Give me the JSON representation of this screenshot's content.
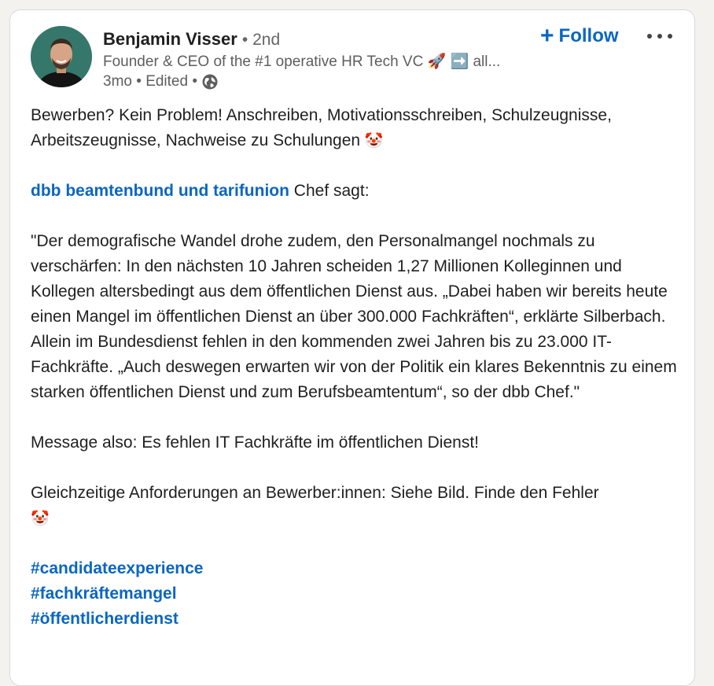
{
  "post": {
    "author": {
      "name": "Benjamin Visser",
      "degree": "• 2nd",
      "headline": "Founder & CEO of the #1 operative HR Tech VC 🚀 ➡️ all...",
      "time": "3mo",
      "edited": "Edited",
      "visibility_icon": "globe-icon"
    },
    "follow_label": "Follow",
    "follow_plus": "+",
    "more_icon": "more-options-icon",
    "text": {
      "p1": "Bewerben? Kein Problem! Anschreiben, Motivationsschreiben, Schulzeugnisse, Arbeitszeugnisse, Nachweise zu Schulungen",
      "p1_emoji": "🤡",
      "mention": "dbb beamtenbund und tarifunion",
      "mention_suffix": " Chef sagt:",
      "quote": "\"Der demografische Wandel drohe zudem, den Personalmangel  nochmals zu verschärfen: In den nächsten 10 Jahren scheiden 1,27 Millionen Kolleginnen und Kollegen altersbedingt aus dem öffentlichen Dienst aus. „Dabei haben wir bereits heute einen Mangel im öffentlichen Dienst an über 300.000 Fachkräften“, erklärte Silberbach. Allein im Bundesdienst fehlen in den kommenden zwei Jahren bis zu 23.000 IT-Fachkräfte. „Auch deswegen erwarten wir von der Politik ein klares Bekenntnis zu einem starken öffentlichen Dienst und zum Berufsbeamtentum“, so der dbb Chef.\"",
      "message": "Message also: Es fehlen IT Fachkräfte im öffentlichen Dienst!",
      "requirements": "Gleichzeitige Anforderungen an Bewerber:innen: Siehe Bild. Finde den Fehler",
      "requirements_emoji": "🤡",
      "hashtags": [
        "#candidateexperience",
        "#fachkräftemangel",
        "#öffentlicherdienst"
      ]
    }
  },
  "colors": {
    "link": "#0a66c2",
    "text": "#1f1f1f",
    "muted": "#5e5e5e"
  }
}
